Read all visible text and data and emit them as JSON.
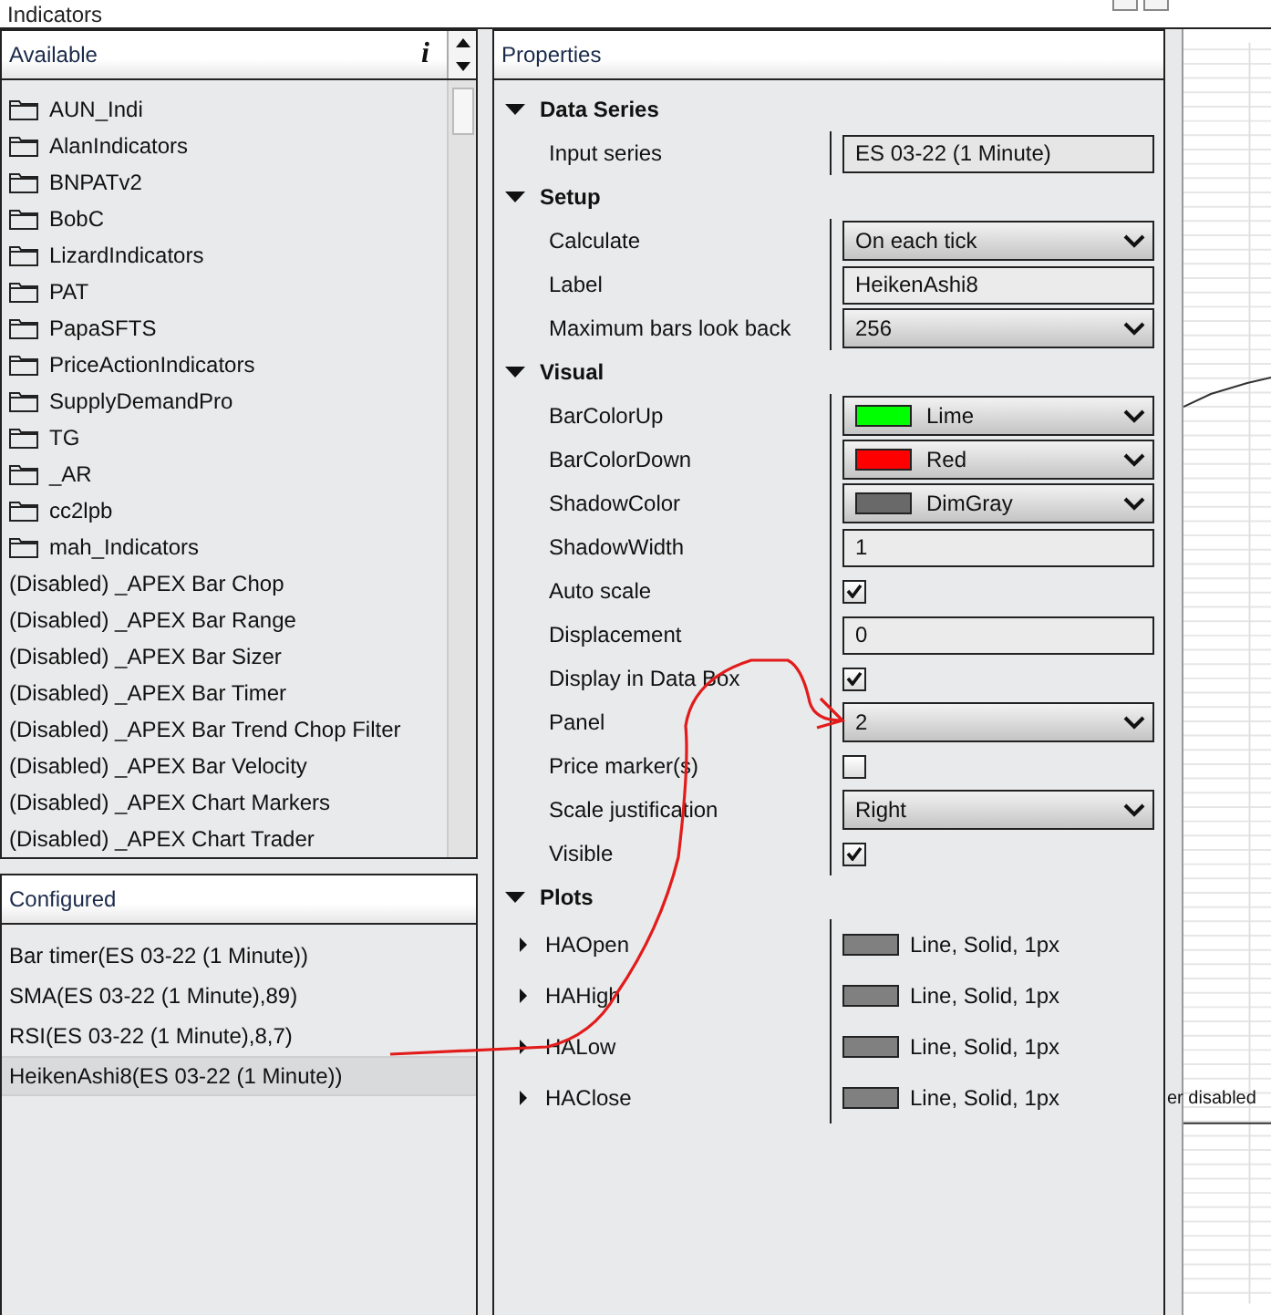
{
  "window": {
    "title": "Indicators"
  },
  "available": {
    "title": "Available",
    "info_label": "i",
    "items": [
      {
        "kind": "folder",
        "label": "AUN_Indi"
      },
      {
        "kind": "folder",
        "label": "AlanIndicators"
      },
      {
        "kind": "folder",
        "label": "BNPATv2"
      },
      {
        "kind": "folder",
        "label": "BobC"
      },
      {
        "kind": "folder",
        "label": "LizardIndicators"
      },
      {
        "kind": "folder",
        "label": "PAT"
      },
      {
        "kind": "folder",
        "label": "PapaSFTS"
      },
      {
        "kind": "folder",
        "label": "PriceActionIndicators"
      },
      {
        "kind": "folder",
        "label": "SupplyDemandPro"
      },
      {
        "kind": "folder",
        "label": "TG"
      },
      {
        "kind": "folder",
        "label": "_AR"
      },
      {
        "kind": "folder",
        "label": "cc2lpb"
      },
      {
        "kind": "folder",
        "label": "mah_Indicators"
      },
      {
        "kind": "indicator",
        "label": "(Disabled) _APEX Bar Chop"
      },
      {
        "kind": "indicator",
        "label": "(Disabled) _APEX Bar Range"
      },
      {
        "kind": "indicator",
        "label": "(Disabled) _APEX Bar Sizer"
      },
      {
        "kind": "indicator",
        "label": "(Disabled) _APEX Bar Timer"
      },
      {
        "kind": "indicator",
        "label": "(Disabled) _APEX Bar Trend Chop Filter"
      },
      {
        "kind": "indicator",
        "label": "(Disabled) _APEX Bar Velocity"
      },
      {
        "kind": "indicator",
        "label": "(Disabled) _APEX Chart Markers"
      },
      {
        "kind": "indicator",
        "label": "(Disabled) _APEX Chart Trader"
      }
    ]
  },
  "configured": {
    "title": "Configured",
    "items": [
      {
        "label": "Bar timer(ES 03-22 (1 Minute))",
        "selected": false
      },
      {
        "label": "SMA(ES 03-22 (1 Minute),89)",
        "selected": false
      },
      {
        "label": "RSI(ES 03-22 (1 Minute),8,7)",
        "selected": false
      },
      {
        "label": "HeikenAshi8(ES 03-22 (1 Minute))",
        "selected": true
      }
    ]
  },
  "properties": {
    "title": "Properties",
    "categories": [
      {
        "name": "Data Series",
        "expanded": true,
        "rows": [
          {
            "kind": "readonly",
            "label": "Input series",
            "value": "ES 03-22 (1 Minute)"
          }
        ]
      },
      {
        "name": "Setup",
        "expanded": true,
        "rows": [
          {
            "kind": "select",
            "label": "Calculate",
            "value": "On each tick"
          },
          {
            "kind": "text",
            "label": "Label",
            "value": "HeikenAshi8"
          },
          {
            "kind": "select",
            "label": "Maximum bars look back",
            "value": "256"
          }
        ]
      },
      {
        "name": "Visual",
        "expanded": true,
        "rows": [
          {
            "kind": "color",
            "label": "BarColorUp",
            "value": "Lime",
            "color": "#00ff00"
          },
          {
            "kind": "color",
            "label": "BarColorDown",
            "value": "Red",
            "color": "#ff0000"
          },
          {
            "kind": "color",
            "label": "ShadowColor",
            "value": "DimGray",
            "color": "#696969"
          },
          {
            "kind": "text",
            "label": "ShadowWidth",
            "value": "1"
          },
          {
            "kind": "checkbox",
            "label": "Auto scale",
            "checked": true
          },
          {
            "kind": "text",
            "label": "Displacement",
            "value": "0"
          },
          {
            "kind": "checkbox",
            "label": "Display in Data Box",
            "checked": true
          },
          {
            "kind": "select",
            "label": "Panel",
            "value": "2"
          },
          {
            "kind": "checkbox",
            "label": "Price marker(s)",
            "checked": false
          },
          {
            "kind": "select",
            "label": "Scale justification",
            "value": "Right"
          },
          {
            "kind": "checkbox",
            "label": "Visible",
            "checked": true
          }
        ]
      },
      {
        "name": "Plots",
        "expanded": true,
        "rows": [
          {
            "kind": "plot",
            "label": "HAOpen",
            "value": "Line, Solid, 1px",
            "expanded": false
          },
          {
            "kind": "plot",
            "label": "HAHigh",
            "value": "Line, Solid, 1px",
            "expanded": false
          },
          {
            "kind": "plot",
            "label": "HALow",
            "value": "Line, Solid, 1px",
            "expanded": false
          },
          {
            "kind": "plot",
            "label": "HAClose",
            "value": "Line, Solid, 1px",
            "expanded": false
          }
        ]
      }
    ]
  },
  "chart": {
    "note": "er disabled"
  }
}
